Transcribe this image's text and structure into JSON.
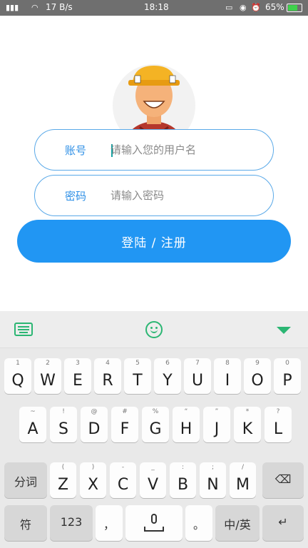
{
  "status_bar": {
    "network_speed": "17 B/s",
    "time": "18:18",
    "battery": "65%"
  },
  "form": {
    "account_label": "账号",
    "account_placeholder": "请输入您的用户名",
    "password_label": "密码",
    "password_placeholder": "请输入密码",
    "submit_label": "登陆 / 注册"
  },
  "keyboard": {
    "row1": [
      {
        "main": "Q",
        "sub": "1"
      },
      {
        "main": "W",
        "sub": "2"
      },
      {
        "main": "E",
        "sub": "3"
      },
      {
        "main": "R",
        "sub": "4"
      },
      {
        "main": "T",
        "sub": "5"
      },
      {
        "main": "Y",
        "sub": "6"
      },
      {
        "main": "U",
        "sub": "7"
      },
      {
        "main": "I",
        "sub": "8"
      },
      {
        "main": "O",
        "sub": "9"
      },
      {
        "main": "P",
        "sub": "0"
      }
    ],
    "row2": [
      {
        "main": "A",
        "sub": "~"
      },
      {
        "main": "S",
        "sub": "!"
      },
      {
        "main": "D",
        "sub": "@"
      },
      {
        "main": "F",
        "sub": "#"
      },
      {
        "main": "G",
        "sub": "%"
      },
      {
        "main": "H",
        "sub": "“"
      },
      {
        "main": "J",
        "sub": "”"
      },
      {
        "main": "K",
        "sub": "*"
      },
      {
        "main": "L",
        "sub": "?"
      }
    ],
    "row3": [
      {
        "main": "Z",
        "sub": "("
      },
      {
        "main": "X",
        "sub": ")"
      },
      {
        "main": "C",
        "sub": "-"
      },
      {
        "main": "V",
        "sub": "_"
      },
      {
        "main": "B",
        "sub": ":"
      },
      {
        "main": "N",
        "sub": ";"
      },
      {
        "main": "M",
        "sub": "/"
      }
    ],
    "segment_key": "分词",
    "symbol_key": "符",
    "number_key": "123",
    "comma_key": "，",
    "period_key": "。",
    "lang_key": "中/英"
  },
  "colors": {
    "accent": "#2196f3",
    "field_border": "#5aa9e8",
    "label": "#2d8fe6"
  }
}
